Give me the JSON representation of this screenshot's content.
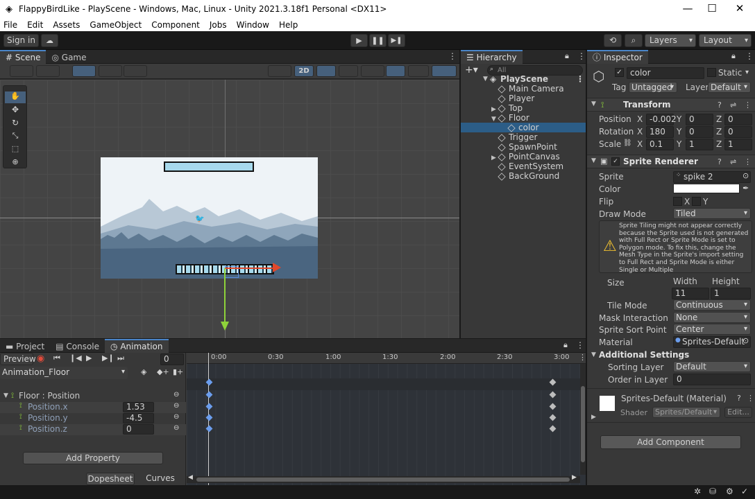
{
  "window": {
    "title": "FlappyBirdLike - PlayScene - Windows, Mac, Linux - Unity 2021.3.18f1 Personal <DX11>"
  },
  "menu": [
    "File",
    "Edit",
    "Assets",
    "GameObject",
    "Component",
    "Jobs",
    "Window",
    "Help"
  ],
  "toolbar": {
    "sign_in": "Sign in",
    "layers": "Layers",
    "layout": "Layout"
  },
  "scene": {
    "tabs": [
      "Scene",
      "Game"
    ],
    "mode2d": "2D"
  },
  "hierarchy": {
    "title": "Hierarchy",
    "search_placeholder": "All",
    "scene_name": "PlayScene",
    "items": [
      {
        "label": "Main Camera"
      },
      {
        "label": "Player"
      },
      {
        "label": "Top"
      },
      {
        "label": "Floor"
      },
      {
        "label": "color"
      },
      {
        "label": "Trigger"
      },
      {
        "label": "SpawnPoint"
      },
      {
        "label": "PointCanvas"
      },
      {
        "label": "EventSystem"
      },
      {
        "label": "BackGround"
      }
    ]
  },
  "inspector": {
    "title": "Inspector",
    "object_name": "color",
    "static_label": "Static",
    "tag_label": "Tag",
    "tag_value": "Untagged",
    "layer_label": "Layer",
    "layer_value": "Default",
    "transform": {
      "title": "Transform",
      "position_label": "Position",
      "position": [
        "-0.002",
        "0",
        "0"
      ],
      "rotation_label": "Rotation",
      "rotation": [
        "180",
        "0",
        "0"
      ],
      "scale_label": "Scale",
      "scale": [
        "0.1",
        "1",
        "1"
      ]
    },
    "sprite_renderer": {
      "title": "Sprite Renderer",
      "sprite_label": "Sprite",
      "sprite_value": "spike 2",
      "color_label": "Color",
      "flip_label": "Flip",
      "flip_x": "X",
      "flip_y": "Y",
      "draw_mode_label": "Draw Mode",
      "draw_mode_value": "Tiled",
      "warning": "Sprite Tiling might not appear correctly because the Sprite used is not generated with Full Rect or Sprite Mode is set to Polygon mode. To fix this, change the Mesh Type in the Sprite's import setting to Full Rect and Sprite Mode is either Single or Multiple",
      "size_label": "Size",
      "width_label": "Width",
      "height_label": "Height",
      "width_value": "11",
      "height_value": "1",
      "tile_mode_label": "Tile Mode",
      "tile_mode_value": "Continuous",
      "mask_label": "Mask Interaction",
      "mask_value": "None",
      "sort_point_label": "Sprite Sort Point",
      "sort_point_value": "Center",
      "material_label": "Material",
      "material_value": "Sprites-Default",
      "additional_label": "Additional Settings",
      "sorting_layer_label": "Sorting Layer",
      "sorting_layer_value": "Default",
      "order_label": "Order in Layer",
      "order_value": "0"
    },
    "material": {
      "name": "Sprites-Default (Material)",
      "shader_label": "Shader",
      "shader_value": "Sprites/Default",
      "edit": "Edit..."
    },
    "add_component": "Add Component"
  },
  "bottom": {
    "tabs": [
      "Project",
      "Console",
      "Animation"
    ],
    "preview": "Preview",
    "frame": "0",
    "clip": "Animation_Floor",
    "property_group": "Floor : Position",
    "props": [
      {
        "name": "Position.x",
        "value": "1.53"
      },
      {
        "name": "Position.y",
        "value": "-4.5"
      },
      {
        "name": "Position.z",
        "value": "0"
      }
    ],
    "add_property": "Add Property",
    "timeline_labels": [
      "0:00",
      "0:30",
      "1:00",
      "1:30",
      "2:00",
      "2:30",
      "3:00"
    ],
    "dopesheet": "Dopesheet",
    "curves": "Curves"
  },
  "colors": {
    "accent": "#4a85c8",
    "selection": "#2c5d87",
    "sky": "#a7d9ec"
  }
}
